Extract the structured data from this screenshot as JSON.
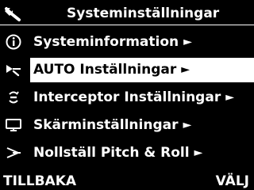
{
  "header": {
    "icon": "wrench-icon",
    "title": "Systeminställningar"
  },
  "menu": {
    "selected_index": 1,
    "arrow": "►",
    "items": [
      {
        "icon": "info-icon",
        "label": "Systeminformation"
      },
      {
        "icon": "auto-trim-icon",
        "label": "AUTO Inställningar"
      },
      {
        "icon": "interceptor-icon",
        "label": "Interceptor Inställningar"
      },
      {
        "icon": "monitor-icon",
        "label": "Skärminställningar"
      },
      {
        "icon": "reset-pitch-roll-icon",
        "label": "Nollställ Pitch & Roll"
      }
    ]
  },
  "softkeys": {
    "left": "TILLBAKA",
    "right": "VÄLJ"
  },
  "colors": {
    "background": "#000000",
    "foreground": "#ffffff",
    "highlight": "#ffffff"
  }
}
